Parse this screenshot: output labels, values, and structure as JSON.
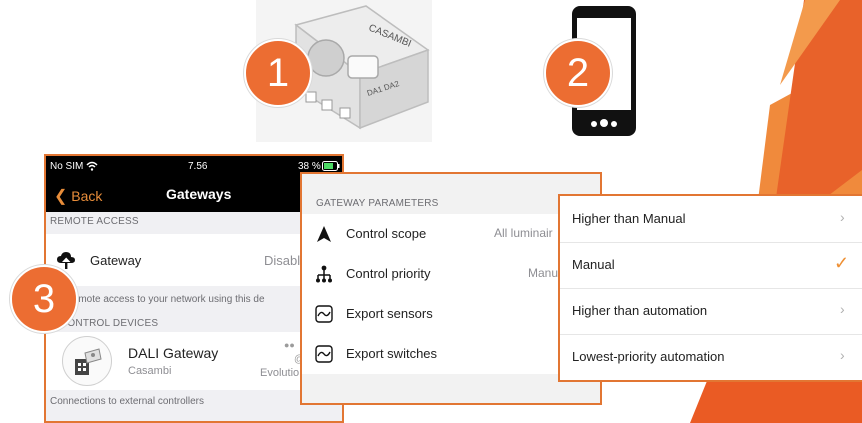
{
  "badges": [
    "1",
    "2",
    "3"
  ],
  "phone": {
    "status_carrier": "No SIM",
    "status_time": "7.56",
    "status_battery": "38 %",
    "back_label": "Back",
    "title": "Gateways",
    "remote_access_header": "REMOTE ACCESS",
    "gateway_label": "Gateway",
    "gateway_value": "Disabl",
    "remote_footer": "t up remote access to your network using this de",
    "control_devices_header": "CONTROL DEVICES",
    "device_name": "DALI Gateway",
    "device_vendor": "Casambi",
    "device_dots": "●●",
    "device_at": "@",
    "device_network": "Evolutio",
    "connections_footer": "Connections to external controllers"
  },
  "params": {
    "header": "GATEWAY PARAMETERS",
    "rows": [
      {
        "label": "Control scope",
        "value": "All luminair"
      },
      {
        "label": "Control priority",
        "value": "Manu"
      },
      {
        "label": "Export sensors",
        "value": ""
      },
      {
        "label": "Export switches",
        "value": ""
      }
    ]
  },
  "menu": {
    "options": [
      "Higher than Manual",
      "Manual",
      "Higher than automation",
      "Lowest-priority automation"
    ],
    "selected": "Manual"
  },
  "device_box_text": "CASAMBI",
  "device_box_subtext": "DA1 DA2",
  "colors": {
    "accent": "#ec6d32",
    "panel_border": "#e27633",
    "toggle": "#ee8f33"
  }
}
